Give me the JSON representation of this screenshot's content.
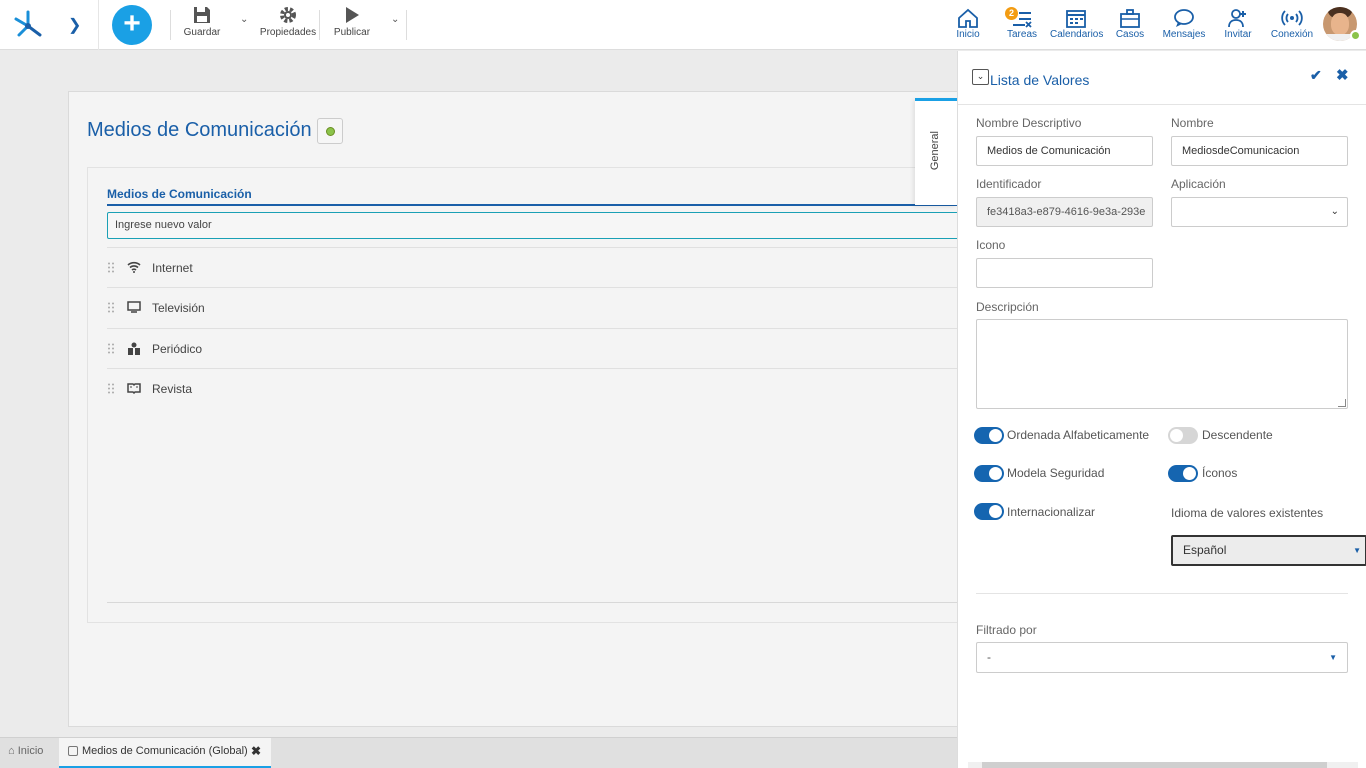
{
  "toolbar": {
    "save_label": "Guardar",
    "properties_label": "Propiedades",
    "publish_label": "Publicar"
  },
  "nav": {
    "home": "Inicio",
    "tasks": "Tareas",
    "tasks_badge": "2",
    "calendars": "Calendarios",
    "cases": "Casos",
    "messages": "Mensajes",
    "invite": "Invitar",
    "connection": "Conexión"
  },
  "main": {
    "title": "Medios de Comunicación",
    "list_title": "Medios de Comunicación",
    "new_value_placeholder": "Ingrese nuevo valor",
    "items": [
      {
        "label": "Internet",
        "icon": "wifi-icon"
      },
      {
        "label": "Televisión",
        "icon": "tv-icon"
      },
      {
        "label": "Periódico",
        "icon": "newspaper-icon"
      },
      {
        "label": "Revista",
        "icon": "magazine-icon"
      }
    ]
  },
  "bottom_tabs": {
    "home": "Inicio",
    "active": "Medios de Comunicación (Global)"
  },
  "panel": {
    "title": "Lista de Valores",
    "vertical_tab": "General",
    "fields": {
      "nombre_descriptivo_label": "Nombre Descriptivo",
      "nombre_descriptivo_value": "Medios de Comunicación",
      "nombre_label": "Nombre",
      "nombre_value": "MediosdeComunicacion",
      "identificador_label": "Identificador",
      "identificador_value": "fe3418a3-e879-4616-9e3a-293e",
      "aplicacion_label": "Aplicación",
      "aplicacion_value": "",
      "icono_label": "Icono",
      "icono_value": "",
      "descripcion_label": "Descripción"
    },
    "toggles": {
      "ordenada": {
        "label": "Ordenada Alfabeticamente",
        "on": true
      },
      "descendente": {
        "label": "Descendente",
        "on": false
      },
      "modela": {
        "label": "Modela Seguridad",
        "on": true
      },
      "iconos": {
        "label": "Íconos",
        "on": true
      },
      "internacionalizar": {
        "label": "Internacionalizar",
        "on": true
      }
    },
    "idioma_label": "Idioma de valores existentes",
    "idioma_value": "Español",
    "filtrado_label": "Filtrado por",
    "filtrado_value": "-"
  },
  "colors": {
    "accent": "#1aa0e5",
    "primary_text": "#1a5fa8",
    "toggle_on": "#1565b0",
    "status": "#8bc34a"
  }
}
